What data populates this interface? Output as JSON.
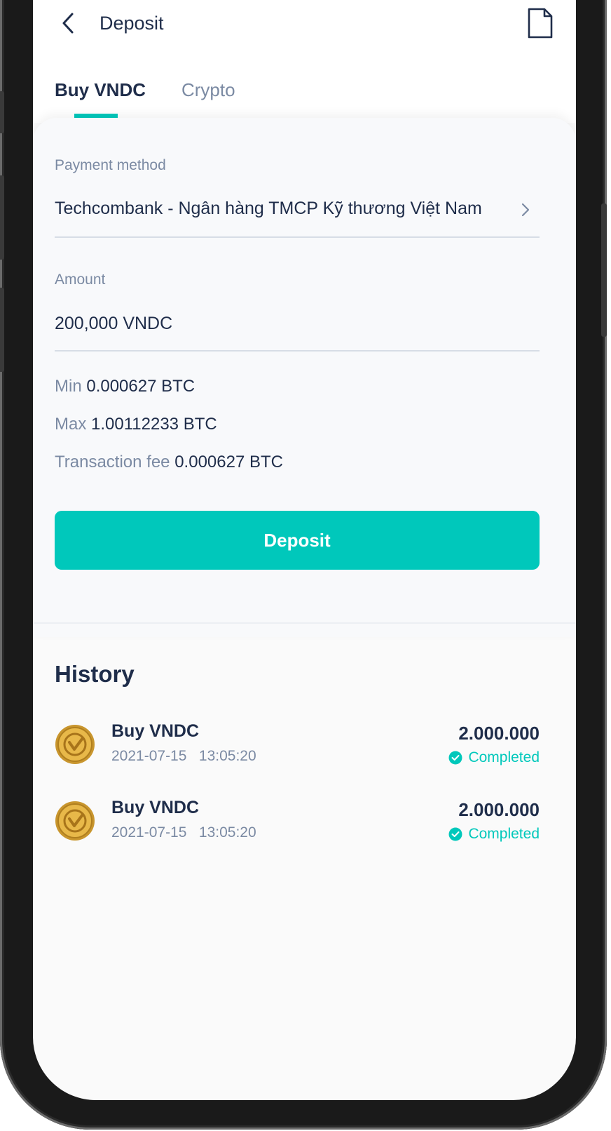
{
  "header": {
    "title": "Deposit"
  },
  "tabs": [
    {
      "label": "Buy VNDC",
      "active": true
    },
    {
      "label": "Crypto",
      "active": false
    }
  ],
  "form": {
    "payment_method_label": "Payment method",
    "payment_method_value": "Techcombank - Ngân hàng TMCP Kỹ thương Việt Nam",
    "amount_label": "Amount",
    "amount_value": "200,000 VNDC",
    "min_label": "Min",
    "min_value": "0.000627 BTC",
    "max_label": "Max",
    "max_value": "1.00112233 BTC",
    "fee_label": "Transaction fee",
    "fee_value": "0.000627 BTC",
    "deposit_button": "Deposit"
  },
  "history": {
    "title": "History",
    "items": [
      {
        "title": "Buy VNDC",
        "time": "2021-07-15   13:05:20",
        "amount": "2.000.000",
        "status": "Completed"
      },
      {
        "title": "Buy VNDC",
        "time": "2021-07-15   13:05:20",
        "amount": "2.000.000",
        "status": "Completed"
      }
    ]
  },
  "colors": {
    "accent": "#00c8bb",
    "text": "#1f2d4a",
    "muted": "#7b8aa3"
  },
  "icons": {
    "back": "chevron-left-icon",
    "document": "document-icon",
    "forward": "chevron-right-icon",
    "status": "check-circle-icon",
    "coin": "vndc-coin-icon"
  }
}
